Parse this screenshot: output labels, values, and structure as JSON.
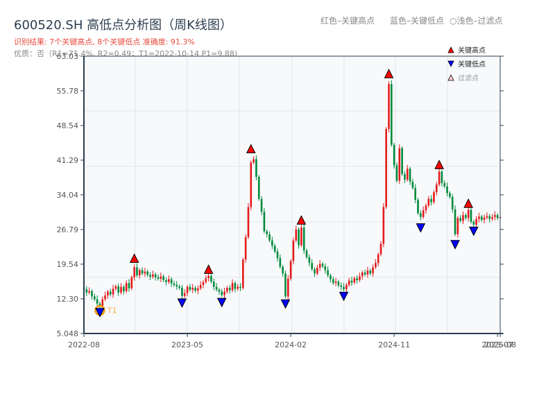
{
  "header": {
    "title": "600520.SH 高低点分析图（周K线图）",
    "result": "识别结果: 7个关键高点, 8个关键低点  准确度: 91.3%",
    "quality": "优质：否（R1=71.4%, R2=0.49；T1=2022-10-14 P1=9.88)",
    "note_red": "红色–关键高点",
    "note_blue": "蓝色–关键低点",
    "note_light": "○浅色–过滤点"
  },
  "chart_data": {
    "type": "candlestick",
    "title": "600520.SH 高低点分析图（周K线图）",
    "ylim": [
      5.048,
      63.03
    ],
    "yticks": [
      "63.03",
      "55.78",
      "48.54",
      "41.29",
      "34.04",
      "26.79",
      "19.54",
      "12.30",
      "5.048"
    ],
    "xticks": [
      {
        "label": "2022-08",
        "week": 0
      },
      {
        "label": "2023-05",
        "week": 39
      },
      {
        "label": "2024-02",
        "week": 78
      },
      {
        "label": "2024-11",
        "week": 117
      },
      {
        "label": "2025-07",
        "week": 156
      },
      {
        "label": "2025-08",
        "week": 157
      }
    ],
    "grid": true,
    "legend": {
      "placement": "top-right",
      "items": [
        {
          "label": "关键高点",
          "symbol": "triangle-up",
          "color": "#ff0000"
        },
        {
          "label": "关键低点",
          "symbol": "triangle-down",
          "color": "#0000ff"
        },
        {
          "label": "过滤点",
          "symbol": "triangle-up-light",
          "color": "#ffcccc"
        }
      ]
    },
    "up_color": "#e41a1c",
    "down_color": "#008a3a",
    "closes": [
      14.3,
      13.6,
      13.9,
      12.8,
      12.2,
      11.3,
      10.8,
      12.2,
      13.0,
      13.8,
      13.2,
      14.4,
      14.9,
      13.6,
      14.8,
      13.9,
      15.6,
      14.5,
      16.8,
      18.9,
      17.2,
      18.3,
      17.6,
      18.0,
      17.3,
      16.9,
      17.4,
      16.8,
      16.5,
      17.0,
      16.2,
      15.8,
      16.4,
      15.5,
      15.2,
      14.9,
      14.6,
      12.9,
      13.5,
      14.8,
      14.2,
      14.6,
      14.0,
      14.5,
      15.2,
      15.8,
      16.6,
      17.1,
      15.9,
      14.8,
      14.2,
      13.8,
      13.1,
      13.8,
      14.6,
      14.1,
      15.6,
      14.4,
      14.8,
      14.6,
      20.5,
      25.2,
      31.5,
      40.8,
      41.5,
      37.8,
      33.2,
      30.5,
      26.4,
      25.8,
      24.5,
      23.4,
      22.2,
      20.8,
      19.0,
      17.6,
      12.8,
      16.5,
      20.2,
      24.5,
      26.8,
      23.5,
      27.2,
      22.4,
      21.0,
      19.8,
      18.5,
      17.6,
      18.8,
      19.6,
      19.1,
      18.3,
      17.2,
      16.4,
      15.6,
      15.9,
      15.1,
      14.8,
      14.3,
      15.2,
      16.1,
      15.7,
      16.6,
      16.2,
      17.0,
      17.8,
      17.4,
      18.2,
      17.6,
      18.9,
      19.8,
      21.6,
      23.8,
      31.5,
      47.8,
      57.2,
      44.5,
      40.2,
      37.0,
      43.8,
      38.4,
      37.2,
      39.5,
      36.8,
      35.5,
      33.0,
      30.2,
      29.4,
      30.8,
      31.8,
      33.2,
      32.5,
      34.6,
      36.2,
      38.9,
      36.5,
      35.8,
      34.4,
      33.6,
      31.0,
      25.8,
      29.2,
      28.6,
      29.8,
      29.2,
      30.9,
      28.4,
      27.8,
      29.0,
      29.5,
      28.8,
      29.3,
      29.6,
      29.0,
      29.4,
      29.8,
      29.2,
      29.4
    ],
    "key_highs": [
      {
        "week": 19,
        "price": 19.9
      },
      {
        "week": 47,
        "price": 17.6
      },
      {
        "week": 63,
        "price": 42.8
      },
      {
        "week": 82,
        "price": 27.9
      },
      {
        "week": 115,
        "price": 58.5
      },
      {
        "week": 134,
        "price": 39.5
      },
      {
        "week": 145,
        "price": 31.4
      }
    ],
    "key_lows": [
      {
        "week": 6,
        "price": 10.3
      },
      {
        "week": 37,
        "price": 12.3
      },
      {
        "week": 52,
        "price": 12.4
      },
      {
        "week": 76,
        "price": 12.1
      },
      {
        "week": 98,
        "price": 13.7
      },
      {
        "week": 127,
        "price": 28.0
      },
      {
        "week": 140,
        "price": 24.5
      },
      {
        "week": 147,
        "price": 27.3
      }
    ],
    "t1": {
      "label": "T1",
      "week": 6,
      "price": 9.88,
      "color": "#f39c12"
    }
  }
}
